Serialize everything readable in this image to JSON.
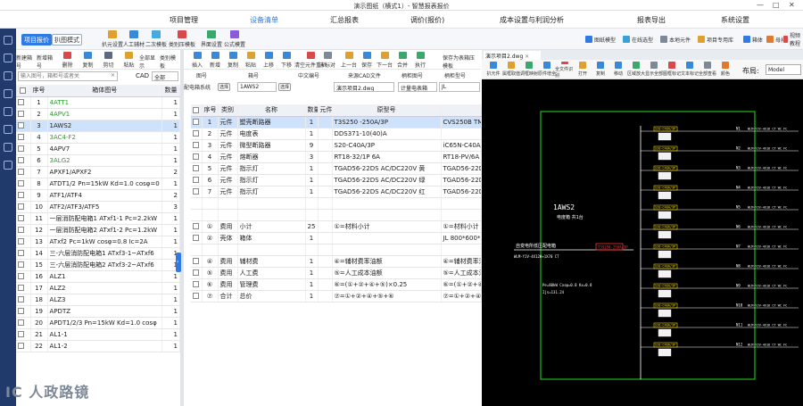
{
  "titlebar": {
    "title": "演示图纸（横式1）- 智慧报表报价",
    "minimize": "—",
    "maximize": "□",
    "close": "✕"
  },
  "nav": [
    {
      "label": "项目管理",
      "color": "#f0a020"
    },
    {
      "label": "设备清单",
      "color": "#2f7ae5",
      "active": true
    },
    {
      "label": "汇总报表",
      "color": "#3a66c4"
    },
    {
      "label": "调价(报价)",
      "color": "#e56a2f"
    },
    {
      "label": "成本设置与利润分析",
      "color": "#3a8ed9"
    },
    {
      "label": "报表导出",
      "color": "#2f7ae5"
    },
    {
      "label": "系统设置",
      "color": "#5b6fa8"
    }
  ],
  "ribbon": {
    "mode1": "项目报价",
    "mode2": "扒图模式",
    "buttons": [
      "扒元设置",
      "人工辅材",
      "二次模板",
      "类别压模板",
      "界面设置",
      "公式模置"
    ],
    "right": [
      "图纸模型",
      "在线选型",
      "本地元件",
      "项目专用库",
      "箱体",
      "母排",
      "视频教程"
    ]
  },
  "lefttool": [
    "新建箱号",
    "新增箱号",
    "删除",
    "复制",
    "剪切",
    "粘贴",
    "全部显示",
    "类别模板"
  ],
  "search": {
    "placeholder": "输入图号，箱柜号或者关",
    "clear": "✕",
    "cad_label": "CAD",
    "filter": "全部"
  },
  "lefttable": {
    "headers": [
      "序号",
      "箱体图号",
      "数量"
    ],
    "rows": [
      {
        "no": "1",
        "name": "4ATT1",
        "qty": "1",
        "color": "#2aa02a"
      },
      {
        "no": "2",
        "name": "4APV1",
        "qty": "1",
        "color": "#2aa02a"
      },
      {
        "no": "3",
        "name": "1AWS2",
        "qty": "1",
        "color": "#222",
        "sel": true
      },
      {
        "no": "4",
        "name": "3AC4-F2",
        "qty": "1",
        "color": "#2aa02a"
      },
      {
        "no": "5",
        "name": "4APV7",
        "qty": "1",
        "color": "#222"
      },
      {
        "no": "6",
        "name": "3ALG2",
        "qty": "1",
        "color": "#2aa02a"
      },
      {
        "no": "7",
        "name": "APXF1/APXF2",
        "qty": "2",
        "color": "#222"
      },
      {
        "no": "8",
        "name": "ATDT1/2 Pn=15kW Kd=1.0 cosφ=0",
        "qty": "1",
        "color": "#222"
      },
      {
        "no": "9",
        "name": "ATF1/ATF4",
        "qty": "2",
        "color": "#222"
      },
      {
        "no": "10",
        "name": "ATF2/ATF3/ATF5",
        "qty": "3",
        "color": "#222"
      },
      {
        "no": "11",
        "name": "一层消防配电箱1 ATxf1-1 Pc=2.2kW",
        "qty": "1",
        "color": "#222"
      },
      {
        "no": "12",
        "name": "一层消防配电箱2 ATxf1-2 Pc=1.2kW",
        "qty": "1",
        "color": "#222"
      },
      {
        "no": "13",
        "name": "ATxf2 Pc=1kW cosφ=0.8 Ic=2A",
        "qty": "1",
        "color": "#222"
      },
      {
        "no": "14",
        "name": "三-六层消防配电箱1 ATxf3-1~ATxf6",
        "qty": "1",
        "color": "#222"
      },
      {
        "no": "15",
        "name": "三-六层消防配电箱2 ATxf3-2~ATxf6",
        "qty": "1",
        "color": "#222"
      },
      {
        "no": "16",
        "name": "ALZ1",
        "qty": "1",
        "color": "#222"
      },
      {
        "no": "17",
        "name": "ALZ2",
        "qty": "1",
        "color": "#222"
      },
      {
        "no": "18",
        "name": "ALZ3",
        "qty": "1",
        "color": "#222"
      },
      {
        "no": "19",
        "name": "APDTZ",
        "qty": "1",
        "color": "#222"
      },
      {
        "no": "20",
        "name": "APDT1/2/3 Pn=15kW Kd=1.0 cosφ",
        "qty": "1",
        "color": "#222"
      },
      {
        "no": "21",
        "name": "AL1-1",
        "qty": "1",
        "color": "#222"
      },
      {
        "no": "22",
        "name": "AL1-2",
        "qty": "1",
        "color": "#222"
      }
    ]
  },
  "midtool": [
    "插入",
    "新增",
    "复制",
    "粘贴",
    "上移",
    "下移",
    "清空元件重扒",
    "未标对",
    "上一台",
    "保存",
    "下一台",
    "合并",
    "执行",
    "保存为表箱压模板"
  ],
  "midfields": {
    "col_labels": [
      "图号",
      "箱号",
      "中文编号",
      "来源CAD文件",
      "柄柜图号",
      "柄柜型号"
    ],
    "system_label": "配电箱系统",
    "code": "1AWS2",
    "cad_file": "演示项目2.dwg",
    "meter": "计量电表箱",
    "model": "JL",
    "edit": "选择"
  },
  "maintable": {
    "headers": [
      "序号",
      "类别",
      "名称",
      "数量",
      "元件",
      "原型号",
      ""
    ],
    "rows": [
      {
        "no": "1",
        "cat": "元件",
        "name": "塑壳断路器",
        "qty": "1",
        "spec": "T3S250 -250A/3P",
        "model": "CVS250B TMI",
        "sel": true
      },
      {
        "no": "2",
        "cat": "元件",
        "name": "电度表",
        "qty": "1",
        "spec": "DDS371-10(40)A",
        "model": ""
      },
      {
        "no": "3",
        "cat": "元件",
        "name": "微型断路器",
        "qty": "9",
        "spec": "S20-C40A/3P",
        "model": "iC65N-C40A/"
      },
      {
        "no": "4",
        "cat": "元件",
        "name": "熔断器",
        "qty": "3",
        "spec": "RT18-32/1P 6A",
        "model": "RT18-PV/6A"
      },
      {
        "no": "5",
        "cat": "元件",
        "name": "指示灯",
        "qty": "1",
        "spec": "TGAD56-22DS AC/DC220V 黄",
        "model": "TGAD56-22D"
      },
      {
        "no": "6",
        "cat": "元件",
        "name": "指示灯",
        "qty": "1",
        "spec": "TGAD56-22DS AC/DC220V 绿",
        "model": "TGAD56-22D"
      },
      {
        "no": "7",
        "cat": "元件",
        "name": "指示灯",
        "qty": "1",
        "spec": "TGAD56-22DS AC/DC220V 红",
        "model": "TGAD56-22D"
      },
      {
        "no": "",
        "cat": "",
        "name": "",
        "qty": "",
        "spec": "",
        "model": ""
      },
      {
        "no": "",
        "cat": "",
        "name": "",
        "qty": "",
        "spec": "",
        "model": ""
      },
      {
        "no": "①",
        "cat": "费用",
        "name": "小计",
        "qty": "25",
        "spec": "①=材料小计",
        "model": "①=材料小计"
      },
      {
        "no": "②",
        "cat": "壳体",
        "name": "箱体",
        "qty": "1",
        "spec": "",
        "model": "JL 800*600*2"
      },
      {
        "no": "",
        "cat": "",
        "name": "",
        "qty": "",
        "spec": "",
        "model": ""
      },
      {
        "no": "④",
        "cat": "费用",
        "name": "辅材费",
        "qty": "1",
        "spec": "④=辅材费率油额",
        "model": "④=辅材费率油"
      },
      {
        "no": "⑤",
        "cat": "费用",
        "name": "人工费",
        "qty": "1",
        "spec": "⑤=人工成本油额",
        "model": "⑤=人工成本油"
      },
      {
        "no": "⑥",
        "cat": "费用",
        "name": "管理费",
        "qty": "1",
        "spec": "⑥=(①+②+④+⑤)×0.25",
        "model": "⑥=(①+②+④"
      },
      {
        "no": "⑦",
        "cat": "合计",
        "name": "总价",
        "qty": "1",
        "spec": "⑦=①+②+④+⑤+⑥",
        "model": "⑦=①+②+④+⑤"
      }
    ]
  },
  "cad": {
    "tab": "演示项目2.dwg",
    "tab_close": "✕",
    "tools": [
      "扒元件",
      "属框取值",
      "调框映射",
      "原件增全",
      "全文件识别",
      "打开",
      "复制",
      "移动",
      "区域放大",
      "显示全部",
      "图框标记",
      "文本标记",
      "全部查看",
      "颜色"
    ],
    "layout_label": "布局:",
    "layout_value": "Model",
    "box_label": "1AWS2",
    "box_sub": "电度箱 共1台",
    "inline_text": "自变电所低压配电箱",
    "feeder": "WLM-YJV-4X120+1X70 CT",
    "params": "Pe=80kW Cosφ=0.8 Kx=0.8",
    "ijs": "Ijs=131.24",
    "main_breaker": "T3S250-250A/3P",
    "circuits": [
      {
        "breaker": "S20-C40A/3P",
        "id": "N1",
        "wire": "WLM-YJV-4X16 CT WC FC"
      },
      {
        "breaker": "S20-C40A/3P",
        "id": "N2",
        "wire": "WLM-YJV-4X16 CT WC FC"
      },
      {
        "breaker": "S20-C40A/3P",
        "id": "N3",
        "wire": "WLM-YJV-4X16 CT WC FC"
      },
      {
        "breaker": "S20-C40A/3P",
        "id": "N4",
        "wire": "WLM-YJV-4X16 CT WC FC"
      },
      {
        "breaker": "S20-C40A/3P",
        "id": "N5",
        "wire": "WLM-YJV-4X16 CT WC FC"
      },
      {
        "breaker": "S20-C40A/3P",
        "id": "N6",
        "wire": "WLM-YJV-4X16 CT WC FC"
      },
      {
        "breaker": "S20-C40A/3P",
        "id": "N7",
        "wire": "WLM-YJV-4X16 CT WC FC"
      },
      {
        "breaker": "S20-C40A/3P",
        "id": "N8",
        "wire": "WLM-YJV-4X16 CT WC FC"
      },
      {
        "breaker": "S20-C40A/3P",
        "id": "N9",
        "wire": "WLM-YJV-4X16 CT WC FC"
      },
      {
        "breaker": "S20-C40A/3P",
        "id": "N10",
        "wire": "WLM-YJV-4X16 CT WC FC"
      },
      {
        "breaker": "S20-C40A/3P",
        "id": "N11",
        "wire": "WLM-YJV-4X16 CT WC FC"
      },
      {
        "breaker": "S20-C40A/3P",
        "id": "N12",
        "wire": "WLM-YJV-4X16 CT WC FC"
      }
    ],
    "colors": {
      "frame": "#22e022",
      "line": "#ffffff",
      "label": "#ffe000",
      "red": "#ff3030",
      "box": "#f2f2f2"
    }
  },
  "watermark": "IC 人政路镜",
  "chart_data": {
    "type": "table",
    "categories": [
      "4ATT1",
      "4APV1",
      "1AWS2",
      "3AC4-F2",
      "4APV7",
      "3ALG2",
      "APXF1/APXF2",
      "ATDT1/2",
      "ATF1/ATF4",
      "ATF2/ATF3/ATF5"
    ],
    "values": [
      1,
      1,
      1,
      1,
      1,
      1,
      2,
      1,
      2,
      3
    ]
  }
}
